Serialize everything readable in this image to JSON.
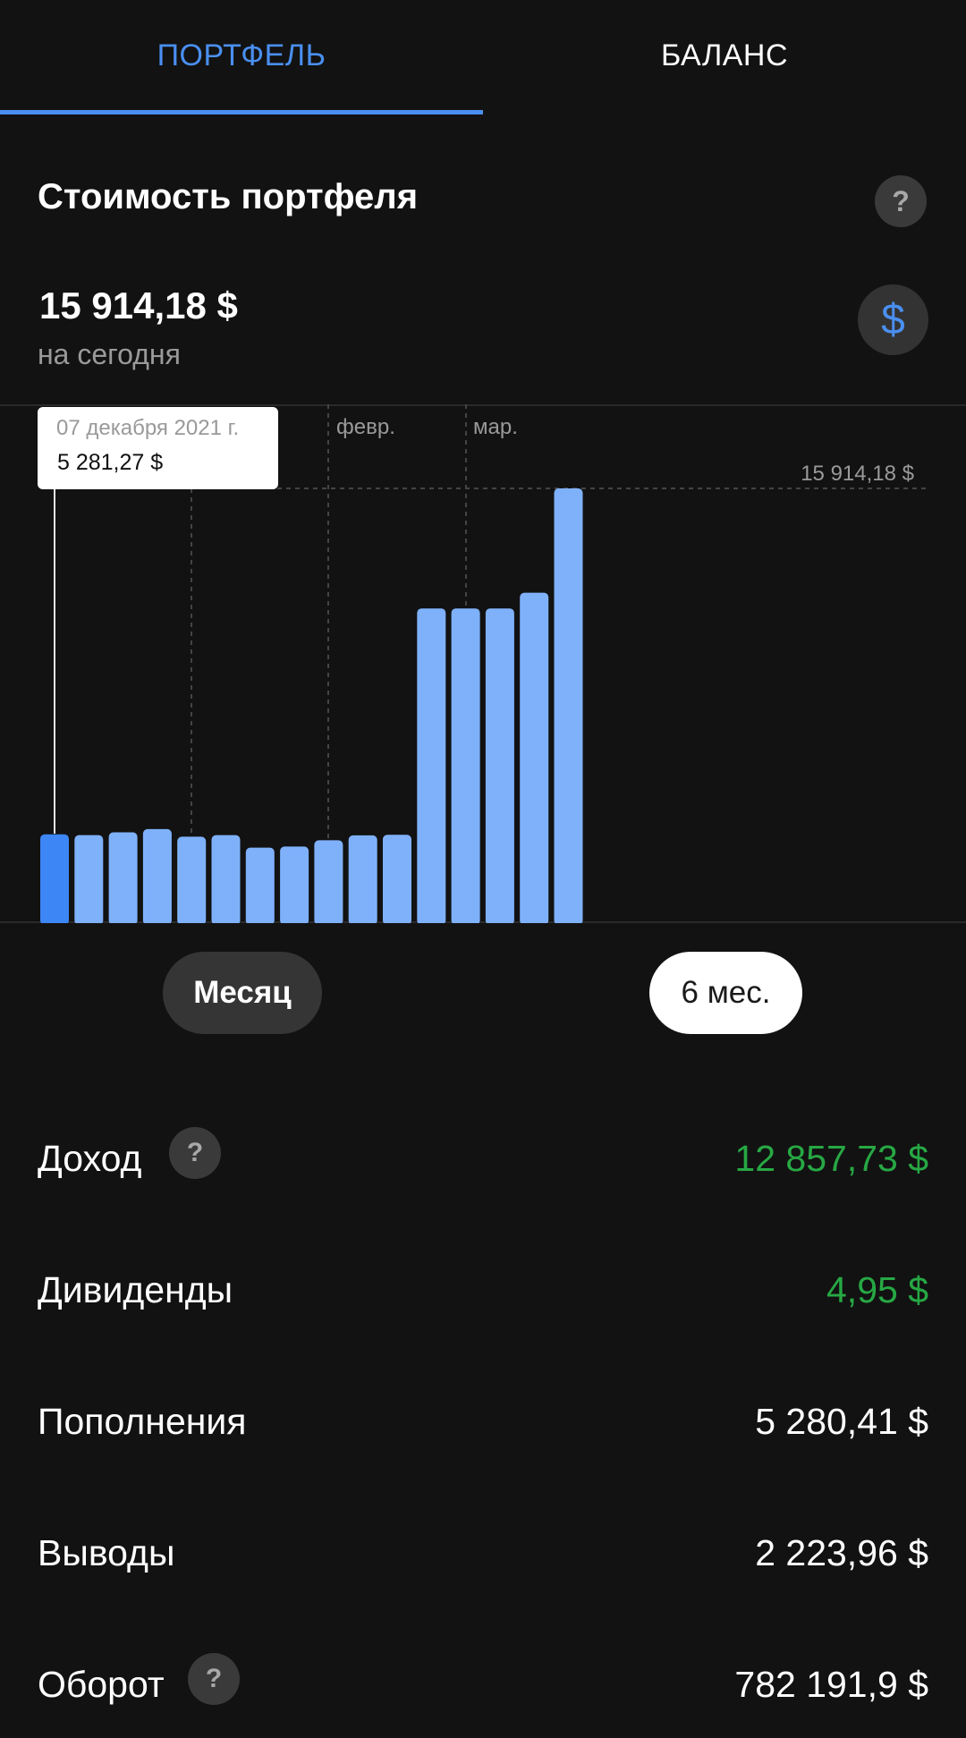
{
  "tabs": [
    {
      "label": "ПОРТФЕЛЬ",
      "active": true
    },
    {
      "label": "БАЛАНС",
      "active": false
    }
  ],
  "header": {
    "title": "Стоимость портфеля",
    "total_value": "15 914,18  $",
    "total_caption": "на сегодня",
    "currency_symbol": "$"
  },
  "tooltip": {
    "date": "07 декабря 2021 г.",
    "value": "5 281,27  $"
  },
  "chart_data": {
    "type": "bar",
    "month_labels": [
      "февр.",
      "мар."
    ],
    "max_label": "15 914,18 $",
    "values": [
      3200,
      3170,
      3270,
      3390,
      3110,
      3170,
      2710,
      2750,
      2980,
      3160,
      3180,
      11500,
      11500,
      11500,
      12080,
      15914.18
    ],
    "highlighted_index": 0,
    "ylim": [
      0,
      15914.18
    ],
    "colors": {
      "bar": "#7fb1fb",
      "bar_selected": "#3d86f5",
      "grid": "#444444"
    }
  },
  "periods": [
    {
      "label": "Месяц",
      "selected": false
    },
    {
      "label": "6 мес.",
      "selected": true
    }
  ],
  "stats": [
    {
      "label": "Доход",
      "value": "12 857,73 $",
      "color": "green",
      "help": "?"
    },
    {
      "label": "Дивиденды",
      "value": "4,95 $",
      "color": "green"
    },
    {
      "label": "Пополнения",
      "value": "5 280,41 $",
      "color": "white"
    },
    {
      "label": "Выводы",
      "value": "2 223,96 $",
      "color": "white"
    },
    {
      "label": "Оборот",
      "value": "782 191,9 $",
      "color": "white",
      "help": "?"
    }
  ],
  "help_symbol": "?"
}
